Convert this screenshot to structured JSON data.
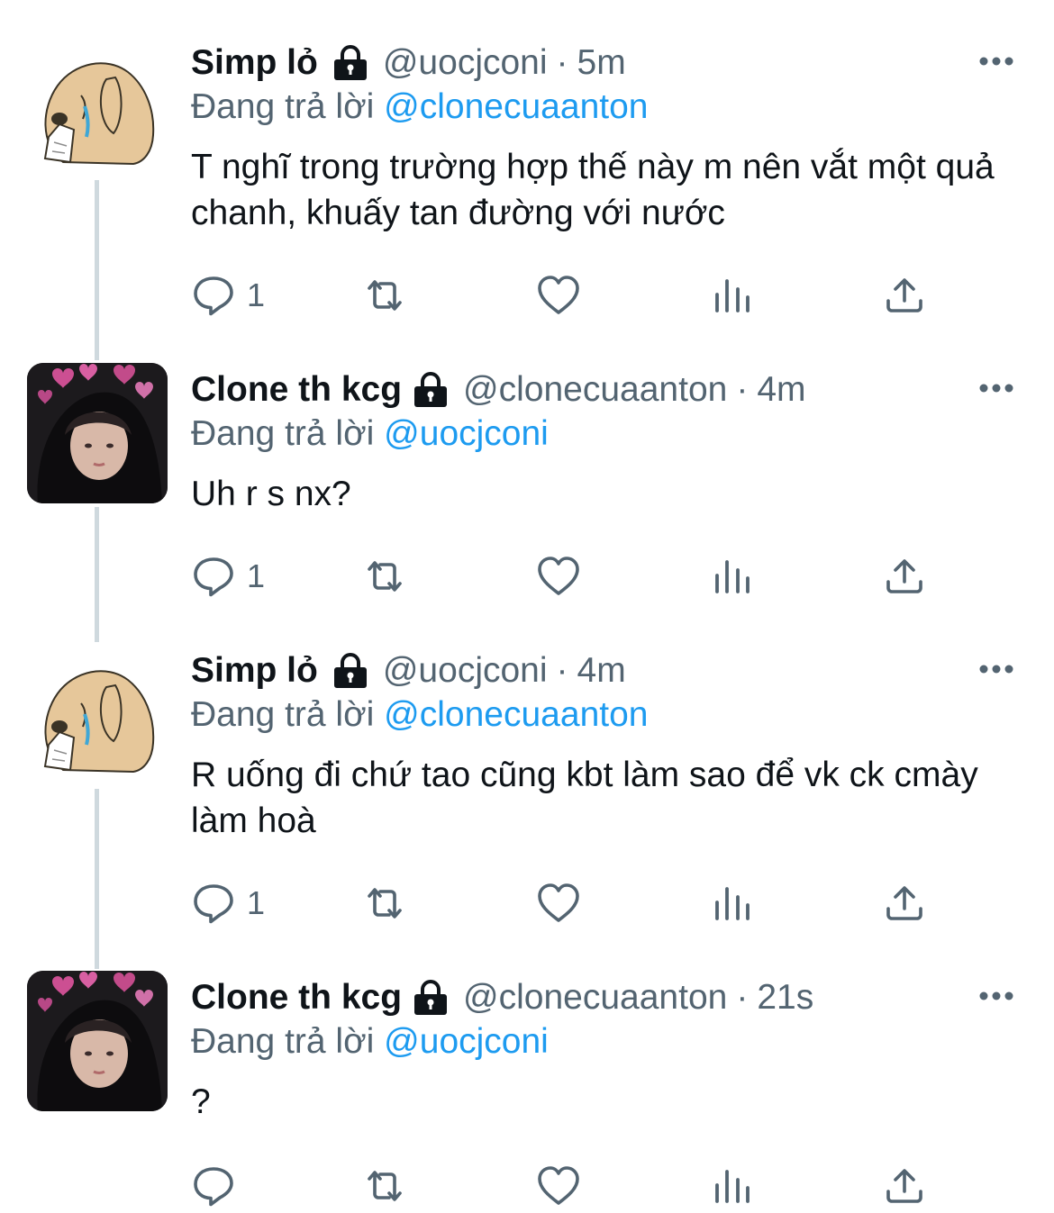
{
  "colors": {
    "text": "#0f1419",
    "secondary": "#536471",
    "link": "#1d9bf0",
    "thread_line": "#cfd9de"
  },
  "icons": {
    "lock": "lock-icon",
    "more": "more-icon",
    "reply": "reply-icon",
    "retweet": "retweet-icon",
    "like": "like-icon",
    "views": "views-icon",
    "share": "share-icon"
  },
  "tweets": [
    {
      "name": "Simp lỏ",
      "handle": "@uocjconi",
      "dot": "·",
      "time": "5m",
      "reply_prefix": "Đang trả lời",
      "reply_to": "@clonecuaanton",
      "text": "T nghĩ trong trường hợp thế này m nên vắt một quả chanh, khuấy tan đường với nước",
      "reply_count": "1"
    },
    {
      "name": "Clone th kcg",
      "handle": "@clonecuaanton",
      "dot": "·",
      "time": "4m",
      "reply_prefix": "Đang trả lời",
      "reply_to": "@uocjconi",
      "text": "Uh r s nx?",
      "reply_count": "1"
    },
    {
      "name": "Simp lỏ",
      "handle": "@uocjconi",
      "dot": "·",
      "time": "4m",
      "reply_prefix": "Đang trả lời",
      "reply_to": "@clonecuaanton",
      "text": "R uống đi chứ tao cũng kbt làm sao để vk ck cmày làm hoà",
      "reply_count": "1"
    },
    {
      "name": "Clone th kcg",
      "handle": "@clonecuaanton",
      "dot": "·",
      "time": "21s",
      "reply_prefix": "Đang trả lời",
      "reply_to": "@uocjconi",
      "text": "?",
      "reply_count": ""
    }
  ]
}
